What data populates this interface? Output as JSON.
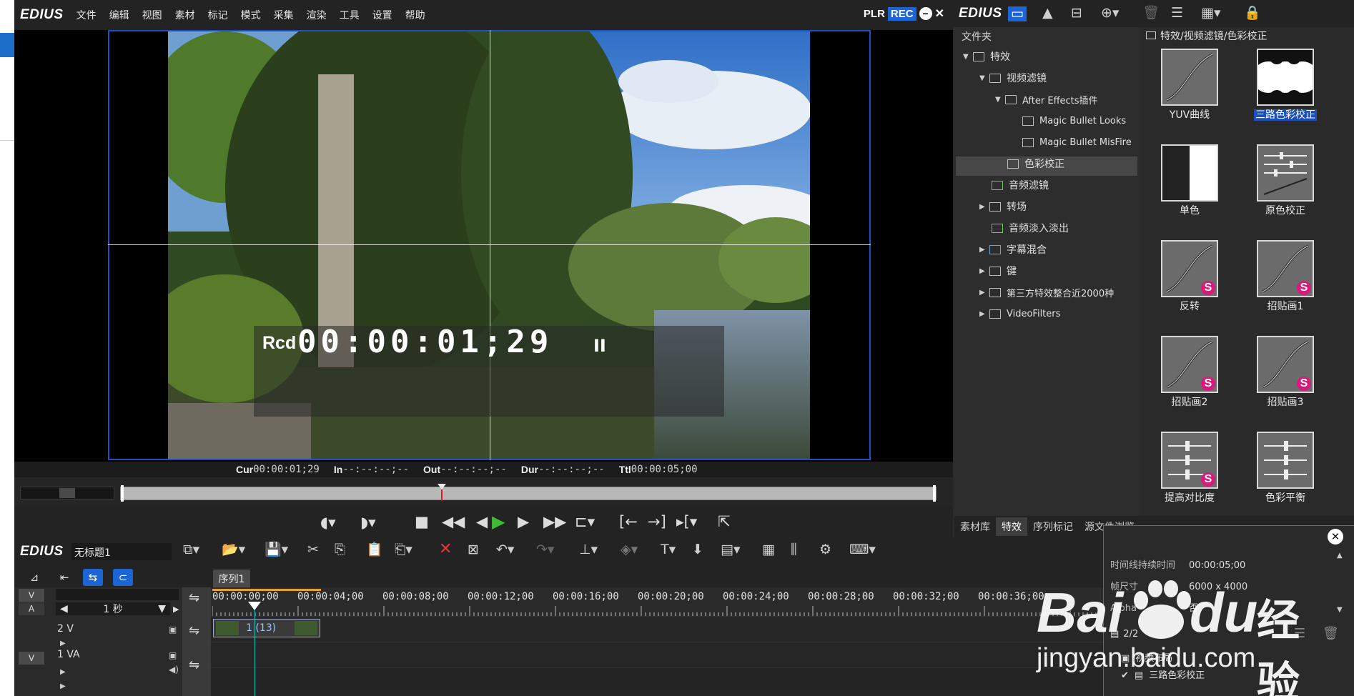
{
  "app": {
    "logo": "EDIUS",
    "menu": [
      "文件",
      "编辑",
      "视图",
      "素材",
      "标记",
      "模式",
      "采集",
      "渲染",
      "工具",
      "设置",
      "帮助"
    ],
    "plr_label": "PLR",
    "rec_label": "REC"
  },
  "player": {
    "rcd_label": "Rcd",
    "timecode": "00:00:01;29",
    "pause_glyph": "II",
    "cur_label": "Cur",
    "cur_value": "00:00:01;29",
    "in_label": "In",
    "in_value": "--:--:--;--",
    "out_label": "Out",
    "out_value": "--:--:--;--",
    "dur_label": "Dur",
    "dur_value": "--:--:--;--",
    "ttl_label": "Ttl",
    "ttl_value": "00:00:05;00"
  },
  "right_panel": {
    "logo": "EDIUS",
    "folder_title": "文件夹",
    "path": "特效/视频滤镜/色彩校正",
    "tree": [
      {
        "label": "特效"
      },
      {
        "label": "视频滤镜"
      },
      {
        "label": "After Effects插件"
      },
      {
        "label": "Magic Bullet Looks"
      },
      {
        "label": "Magic Bullet MisFire"
      },
      {
        "label": "色彩校正"
      },
      {
        "label": "音频滤镜"
      },
      {
        "label": "转场"
      },
      {
        "label": "音频淡入淡出"
      },
      {
        "label": "字幕混合"
      },
      {
        "label": "键"
      },
      {
        "label": "第三方特效整合近2000种"
      },
      {
        "label": "VideoFilters"
      }
    ],
    "effects": [
      {
        "label": "YUV曲线"
      },
      {
        "label": "三路色彩校正"
      },
      {
        "label": "单色"
      },
      {
        "label": "原色校正"
      },
      {
        "label": "反转"
      },
      {
        "label": "招贴画1"
      },
      {
        "label": "招贴画2"
      },
      {
        "label": "招贴画3"
      },
      {
        "label": "提高对比度"
      },
      {
        "label": "色彩平衡"
      }
    ],
    "badge_letter": "S",
    "tabs": [
      "素材库",
      "特效",
      "序列标记",
      "源文件浏览"
    ]
  },
  "timeline": {
    "logo": "EDIUS",
    "project_name": "无标题1",
    "seq_tab": "序列1",
    "zoom": "1 秒",
    "tag_v": "V",
    "tag_a": "A",
    "track_2v": "2 V",
    "track_1va": "1 VA",
    "clip_label": "1 (13)",
    "ruler": [
      "00:00:00;00",
      "00:00:04;00",
      "00:00:08;00",
      "00:00:12;00",
      "00:00:16;00",
      "00:00:20;00",
      "00:00:24;00",
      "00:00:28;00",
      "00:00:32;00",
      "00:00:36;00"
    ]
  },
  "info_panel": {
    "duration_label": "时间线持续时间",
    "duration_value": "00:00:05;00",
    "frame_label": "帧尺寸",
    "frame_value": "6000 x 4000",
    "alpha_label": "Alpha",
    "alpha_value": "否",
    "count": "2/2",
    "item1": "视频布局",
    "item2": "三路色彩校正"
  },
  "watermark": {
    "brand": "Bai",
    "brand2": "du",
    "cn": "经验",
    "url": "jingyan.baidu.com"
  }
}
